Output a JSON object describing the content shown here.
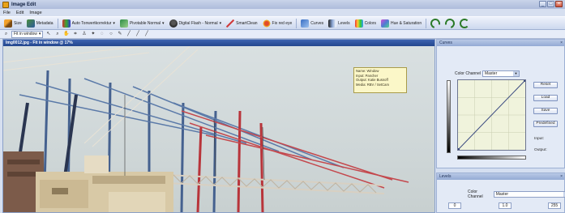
{
  "window": {
    "title": "Image Edit",
    "controls": [
      "_",
      "□",
      "×"
    ]
  },
  "menu": [
    "File",
    "Edit",
    "Image"
  ],
  "toolbar": {
    "size": "Size",
    "metadata": "Metadata",
    "auto_tone": "Auto Tonwertkorrektur",
    "pivotable": "Pivotable Normal",
    "digital_flash": "Digital Flash - Normal",
    "smartclean": "SmartClean",
    "fix_red_eye": "Fix red eye",
    "curves": "Curves",
    "levels": "Levels",
    "colors": "Colors",
    "hue_saturation": "Hue & Saturation"
  },
  "toolbar2": {
    "zoom": "Fit in window"
  },
  "image": {
    "title": "Img0012.jpg - Fit in window @ 17%",
    "info_lines": [
      "Name: Window",
      "Input: Pancher",
      "Output: Katie Busnoff",
      "Media: RBV / SetCam"
    ]
  },
  "curves_panel": {
    "title": "Curves",
    "channel_label": "Color Channel",
    "channel_value": "Master",
    "buttons": [
      "Reset",
      "Load",
      "Save",
      "Predefined"
    ],
    "input_label": "Input:",
    "output_label": "Output:"
  },
  "levels_panel": {
    "title": "Levels",
    "channel_label": "Color Channel",
    "channel_value": "Master",
    "black": "0",
    "gamma": "1.0",
    "white": "255"
  },
  "colors": {
    "title_bar": "#2e55a3",
    "crane_red": "#b8343a",
    "crane_blue": "#3f5f8e",
    "info_bg": "#fbf7c8"
  }
}
